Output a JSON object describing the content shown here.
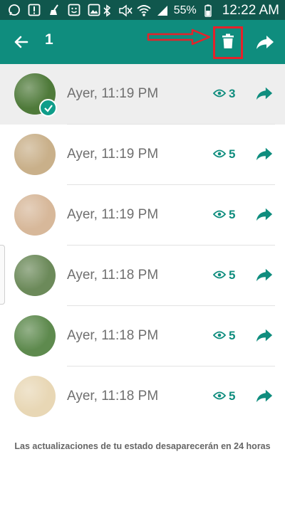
{
  "status_bar": {
    "battery": "55%",
    "time": "12:22 AM",
    "left_icons": [
      "whatsapp-icon",
      "alert-icon",
      "broom-icon",
      "face-icon",
      "image-icon"
    ],
    "right_icons": [
      "bluetooth-icon",
      "mute-icon",
      "wifi-icon",
      "signal-icon",
      "battery-icon"
    ]
  },
  "app_bar": {
    "selected_count": "1",
    "icons": [
      "back-arrow-icon",
      "trash-icon",
      "forward-icon"
    ]
  },
  "status_updates": [
    {
      "time": "Ayer, 11:19 PM",
      "views": "3",
      "selected": true,
      "thumb_color": "#4f7a3a"
    },
    {
      "time": "Ayer, 11:19 PM",
      "views": "5",
      "selected": false,
      "thumb_color": "#c9b08a"
    },
    {
      "time": "Ayer, 11:19 PM",
      "views": "5",
      "selected": false,
      "thumb_color": "#d7b89a"
    },
    {
      "time": "Ayer, 11:18 PM",
      "views": "5",
      "selected": false,
      "thumb_color": "#6c8a5a"
    },
    {
      "time": "Ayer, 11:18 PM",
      "views": "5",
      "selected": false,
      "thumb_color": "#5e8a4e"
    },
    {
      "time": "Ayer, 11:18 PM",
      "views": "5",
      "selected": false,
      "thumb_color": "#e8d7b5"
    }
  ],
  "footer_text": "Las actualizaciones de tu estado desaparecerán en 24 horas",
  "colors": {
    "status_bar": "#10574d",
    "app_bar": "#0f8d7e",
    "accent": "#0f8d7e",
    "annotation_red": "#e5222a",
    "selected_row": "#eeeeee"
  }
}
